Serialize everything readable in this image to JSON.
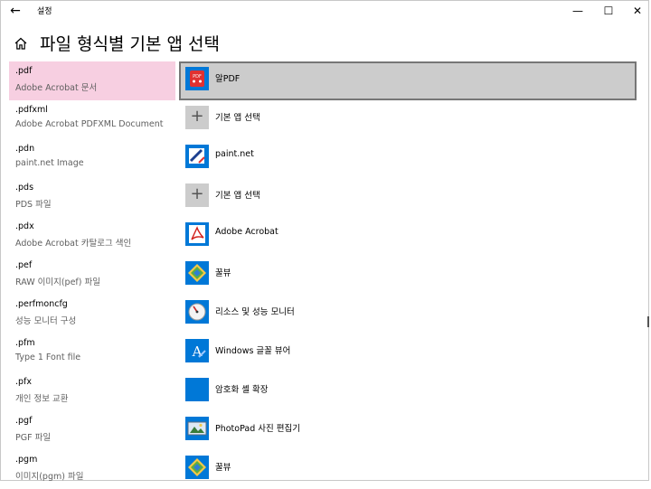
{
  "window": {
    "title": "설정",
    "back_glyph": "←",
    "min_glyph": "—",
    "max_glyph": "☐",
    "close_glyph": "✕"
  },
  "header": {
    "title": "파일 형식별 기본 앱 선택",
    "home_icon": "home-icon"
  },
  "colors": {
    "selected_extension_bg": "#f7cfe1",
    "selected_app_bg": "#cccccc",
    "selected_app_border": "#767676",
    "description_text": "#5f5f5f",
    "icon_blue": "#0078d7"
  },
  "rows": [
    {
      "ext": ".pdf",
      "desc": "Adobe Acrobat 문서",
      "app": "알PDF",
      "icon": "alpdf-icon",
      "selected": true
    },
    {
      "ext": ".pdfxml",
      "desc": "Adobe Acrobat PDFXML Document",
      "app": "기본 앱 선택",
      "icon": "plus-icon"
    },
    {
      "ext": ".pdn",
      "desc": "paint.net Image",
      "app": "paint.net",
      "icon": "paintnet-icon"
    },
    {
      "ext": ".pds",
      "desc": "PDS 파일",
      "app": "기본 앱 선택",
      "icon": "plus-icon"
    },
    {
      "ext": ".pdx",
      "desc": "Adobe Acrobat 카탈로그 색인",
      "app": "Adobe Acrobat",
      "icon": "acrobat-icon"
    },
    {
      "ext": ".pef",
      "desc": "RAW 이미지(pef) 파일",
      "app": "꿀뷰",
      "icon": "honeyview-icon"
    },
    {
      "ext": ".perfmoncfg",
      "desc": "성능 모니터 구성",
      "app": "리소스 및 성능 모니터",
      "icon": "perfmon-icon"
    },
    {
      "ext": ".pfm",
      "desc": "Type 1 Font file",
      "app": "Windows 글꼴 뷰어",
      "icon": "font-viewer-icon"
    },
    {
      "ext": ".pfx",
      "desc": "개인 정보 교환",
      "app": "암호화 셸 확장",
      "icon": "crypto-shell-icon"
    },
    {
      "ext": ".pgf",
      "desc": "PGF 파일",
      "app": "PhotoPad  사진 편집기",
      "icon": "photopad-icon"
    },
    {
      "ext": ".pgm",
      "desc": "이미지(pgm) 파일",
      "app": "꿀뷰",
      "icon": "honeyview-icon"
    }
  ]
}
